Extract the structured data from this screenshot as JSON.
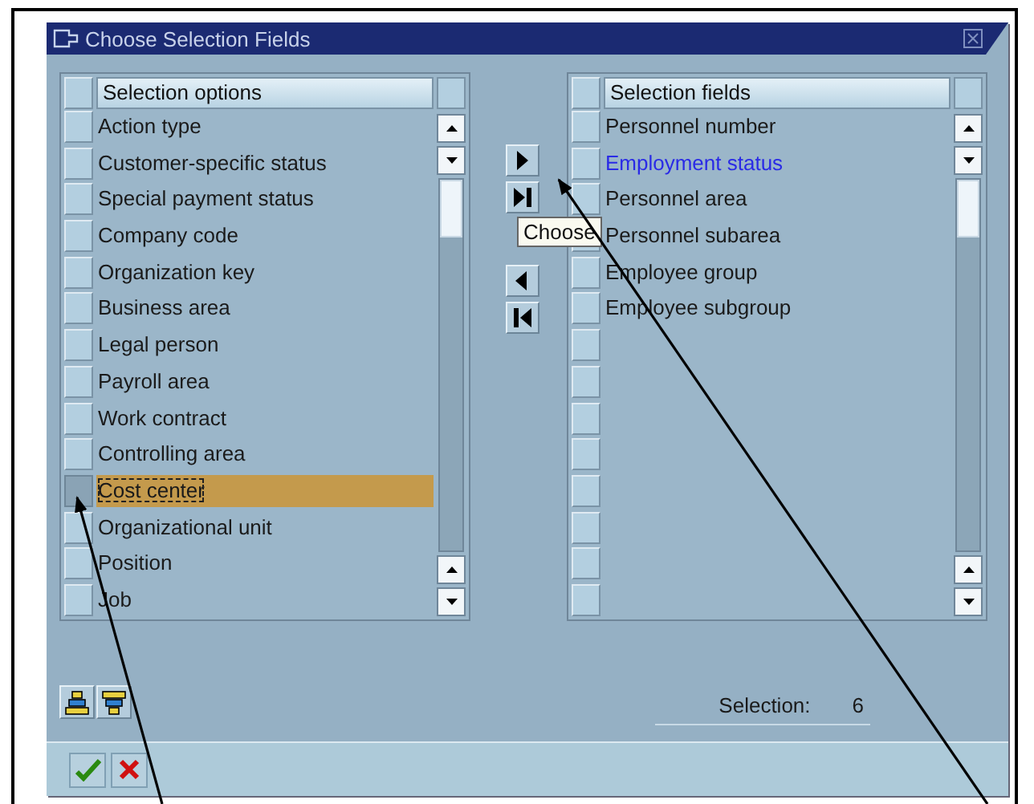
{
  "window": {
    "title": "Choose Selection Fields"
  },
  "options": {
    "header": "Selection options",
    "rows": [
      {
        "label": "Action type",
        "selected": false
      },
      {
        "label": "Customer-specific status",
        "selected": false
      },
      {
        "label": "Special payment status",
        "selected": false
      },
      {
        "label": "Company code",
        "selected": false
      },
      {
        "label": "Organization key",
        "selected": false
      },
      {
        "label": "Business area",
        "selected": false
      },
      {
        "label": "Legal person",
        "selected": false
      },
      {
        "label": "Payroll area",
        "selected": false
      },
      {
        "label": "Work contract",
        "selected": false
      },
      {
        "label": "Controlling area",
        "selected": false
      },
      {
        "label": "Cost center",
        "selected": true
      },
      {
        "label": "Organizational unit",
        "selected": false
      },
      {
        "label": "Position",
        "selected": false
      },
      {
        "label": "Job",
        "selected": false
      }
    ]
  },
  "fields": {
    "header": "Selection fields",
    "rows": [
      {
        "label": "Personnel number",
        "highlighted": false
      },
      {
        "label": "Employment status",
        "highlighted": true
      },
      {
        "label": "Personnel area",
        "highlighted": false
      },
      {
        "label": "Personnel subarea",
        "highlighted": false
      },
      {
        "label": "Employee group",
        "highlighted": false
      },
      {
        "label": "Employee subgroup",
        "highlighted": false
      }
    ]
  },
  "tooltip": "Choose",
  "selection": {
    "label": "Selection:",
    "count": "6"
  }
}
